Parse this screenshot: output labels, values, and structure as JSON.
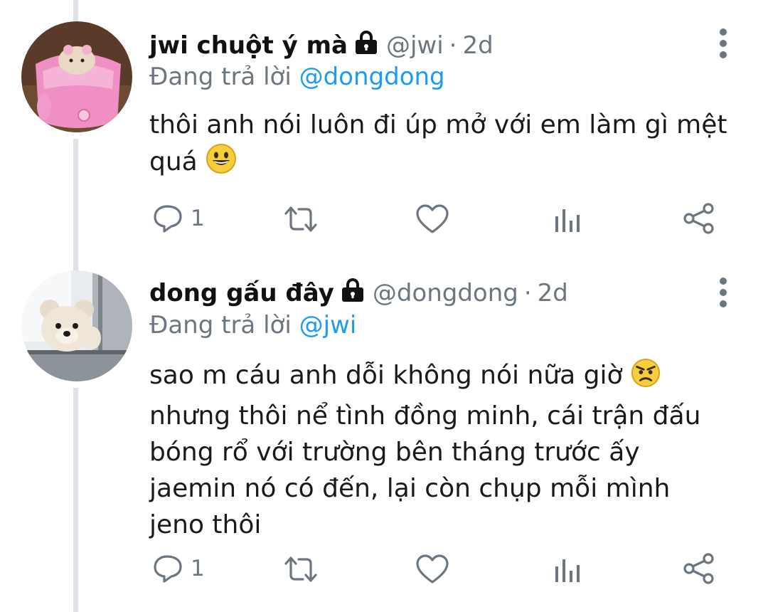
{
  "tweets": [
    {
      "name": "jwi chuột ý mà",
      "handle": "@jwi",
      "separator": "·",
      "time": "2d",
      "replying_prefix": "Đang trả lời",
      "replying_to": "@dongdong",
      "text": "thôi anh nói luôn đi úp mở với em làm gì mệt quá",
      "emoji": "grinning-face",
      "reply_count": "1"
    },
    {
      "name": "dong gấu đây",
      "handle": "@dongdong",
      "separator": "·",
      "time": "2d",
      "replying_prefix": "Đang trả lời",
      "replying_to": "@jwi",
      "text_lines": [
        "sao m cáu anh dỗi không nói nữa giờ",
        "nhưng thôi nể tình đồng minh, cái trận đấu",
        "bóng rổ với trường bên tháng trước ấy",
        "jaemin nó có đến, lại còn chụp mỗi mình",
        "jeno thôi"
      ],
      "emoji": "angry-face",
      "reply_count": "1"
    }
  ],
  "icons": [
    "lock-icon",
    "more-icon",
    "reply-icon",
    "retweet-icon",
    "like-icon",
    "analytics-icon",
    "share-icon"
  ],
  "colors": {
    "link": "#1d9bf0",
    "muted": "#6b7680",
    "thread_line": "#dfe3e8",
    "avatar1": "#e07fb0",
    "avatar2": "#c9ccd0"
  }
}
